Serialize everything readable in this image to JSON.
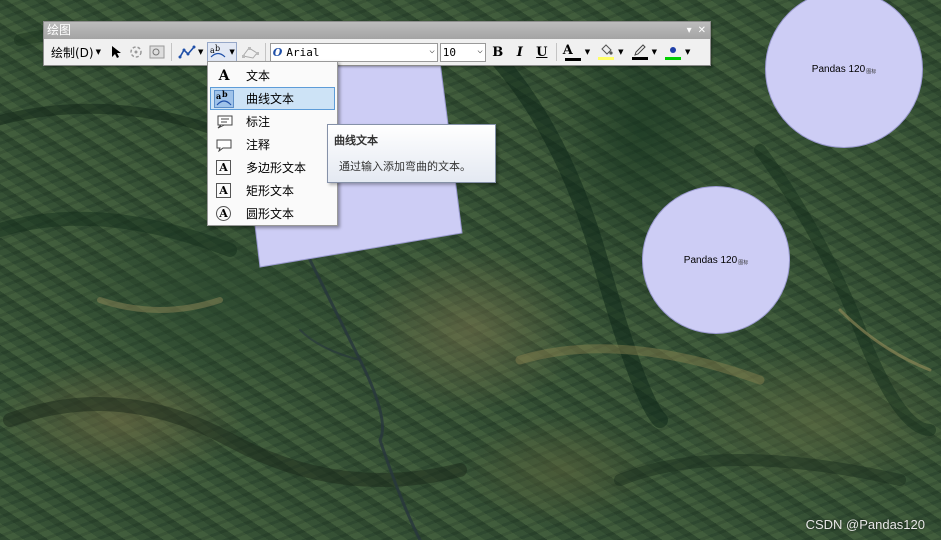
{
  "toolbar": {
    "title": "绘图",
    "pin": "▾",
    "close": "✕",
    "draw_menu_label": "绘制(D)",
    "font_name": "Arial",
    "font_size": "10",
    "bold": "B",
    "italic": "I",
    "underline": "U",
    "font_color_glyph": "A",
    "font_color": "#000000",
    "fill_color": "#ffff66",
    "line_color": "#000000",
    "marker_color": "#00cc00"
  },
  "menu": {
    "items": [
      {
        "label": "文本",
        "icon": "A"
      },
      {
        "label": "曲线文本",
        "icon": "curve-text-icon"
      },
      {
        "label": "标注",
        "icon": "callout-icon"
      },
      {
        "label": "注释",
        "icon": "balloon-icon"
      },
      {
        "label": "多边形文本",
        "icon": "A"
      },
      {
        "label": "矩形文本",
        "icon": "A"
      },
      {
        "label": "圆形文本",
        "icon": "A"
      }
    ]
  },
  "tooltip": {
    "title": "曲线文本",
    "body": "通过输入添加弯曲的文本。"
  },
  "graphics": {
    "circle_a_label": "Pandas 120",
    "circle_a_sub": "图标",
    "circle_b_label": "Pandas 120",
    "circle_b_sub": "图标",
    "fill_color": "#cdcdf5"
  },
  "watermark": "CSDN @Pandas120"
}
